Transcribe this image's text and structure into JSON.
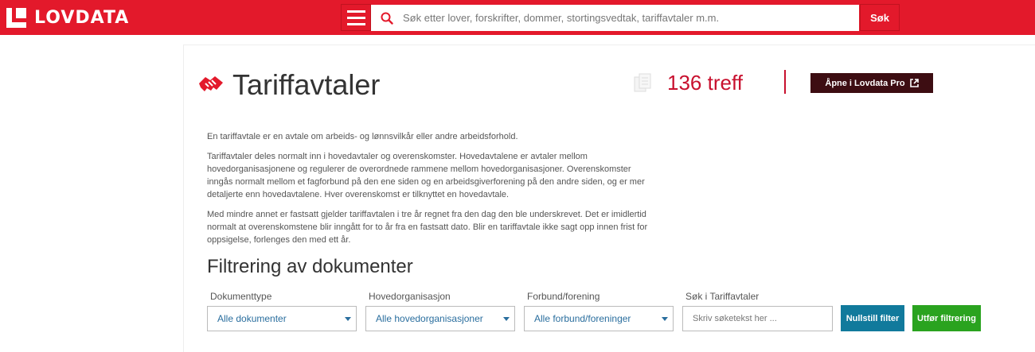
{
  "header": {
    "logo_text": "LOVDATA",
    "search_placeholder": "Søk etter lover, forskrifter, dommer, stortingsvedtak, tariffavtaler m.m.",
    "search_button": "Søk"
  },
  "page": {
    "title": "Tariffavtaler",
    "hits": "136 treff",
    "open_pro_button": "Åpne i Lovdata Pro",
    "description": [
      "En tariffavtale er en avtale om arbeids- og lønnsvilkår eller andre arbeidsforhold.",
      "Tariffavtaler deles normalt inn i hovedavtaler og overenskomster. Hovedavtalene er avtaler mellom hovedorganisasjonene og regulerer de overordnede rammene mellom hovedorganisasjoner. Overenskomster inngås normalt mellom et fagforbund på den ene siden og en arbeidsgiverforening på den andre siden, og er mer detaljerte enn hovedavtalene. Hver overenskomst er tilknyttet en hovedavtale.",
      "Med mindre annet er fastsatt gjelder tariffavtalen i tre år regnet fra den dag den ble underskrevet. Det er imidlertid normalt at overenskomstene blir inngått for to år fra en fastsatt dato. Blir en tariffavtale ikke sagt opp innen frist for oppsigelse, forlenges den med ett år."
    ]
  },
  "filter": {
    "title": "Filtrering av dokumenter",
    "document_type": {
      "label": "Dokumenttype",
      "value": "Alle dokumenter"
    },
    "main_org": {
      "label": "Hovedorganisasjon",
      "value": "Alle hovedorganisasjoner"
    },
    "union": {
      "label": "Forbund/forening",
      "value": "Alle forbund/foreninger"
    },
    "search": {
      "label": "Søk i Tariffavtaler",
      "placeholder": "Skriv søketekst her ..."
    },
    "reset_button": "Nullstill filter",
    "apply_button": "Utfør filtrering"
  },
  "colors": {
    "brand_red": "#e3192b",
    "hits_red": "#c8102e",
    "pro_button": "#3d0d12",
    "reset_button": "#117a9c",
    "apply_button": "#2aa31f",
    "link_blue": "#2a6e9e"
  },
  "icons": {
    "logo": "lovdata-logo-icon",
    "menu": "hamburger-icon",
    "search": "search-icon",
    "title": "handshake-icon",
    "hits": "documents-icon",
    "external": "external-link-icon"
  }
}
